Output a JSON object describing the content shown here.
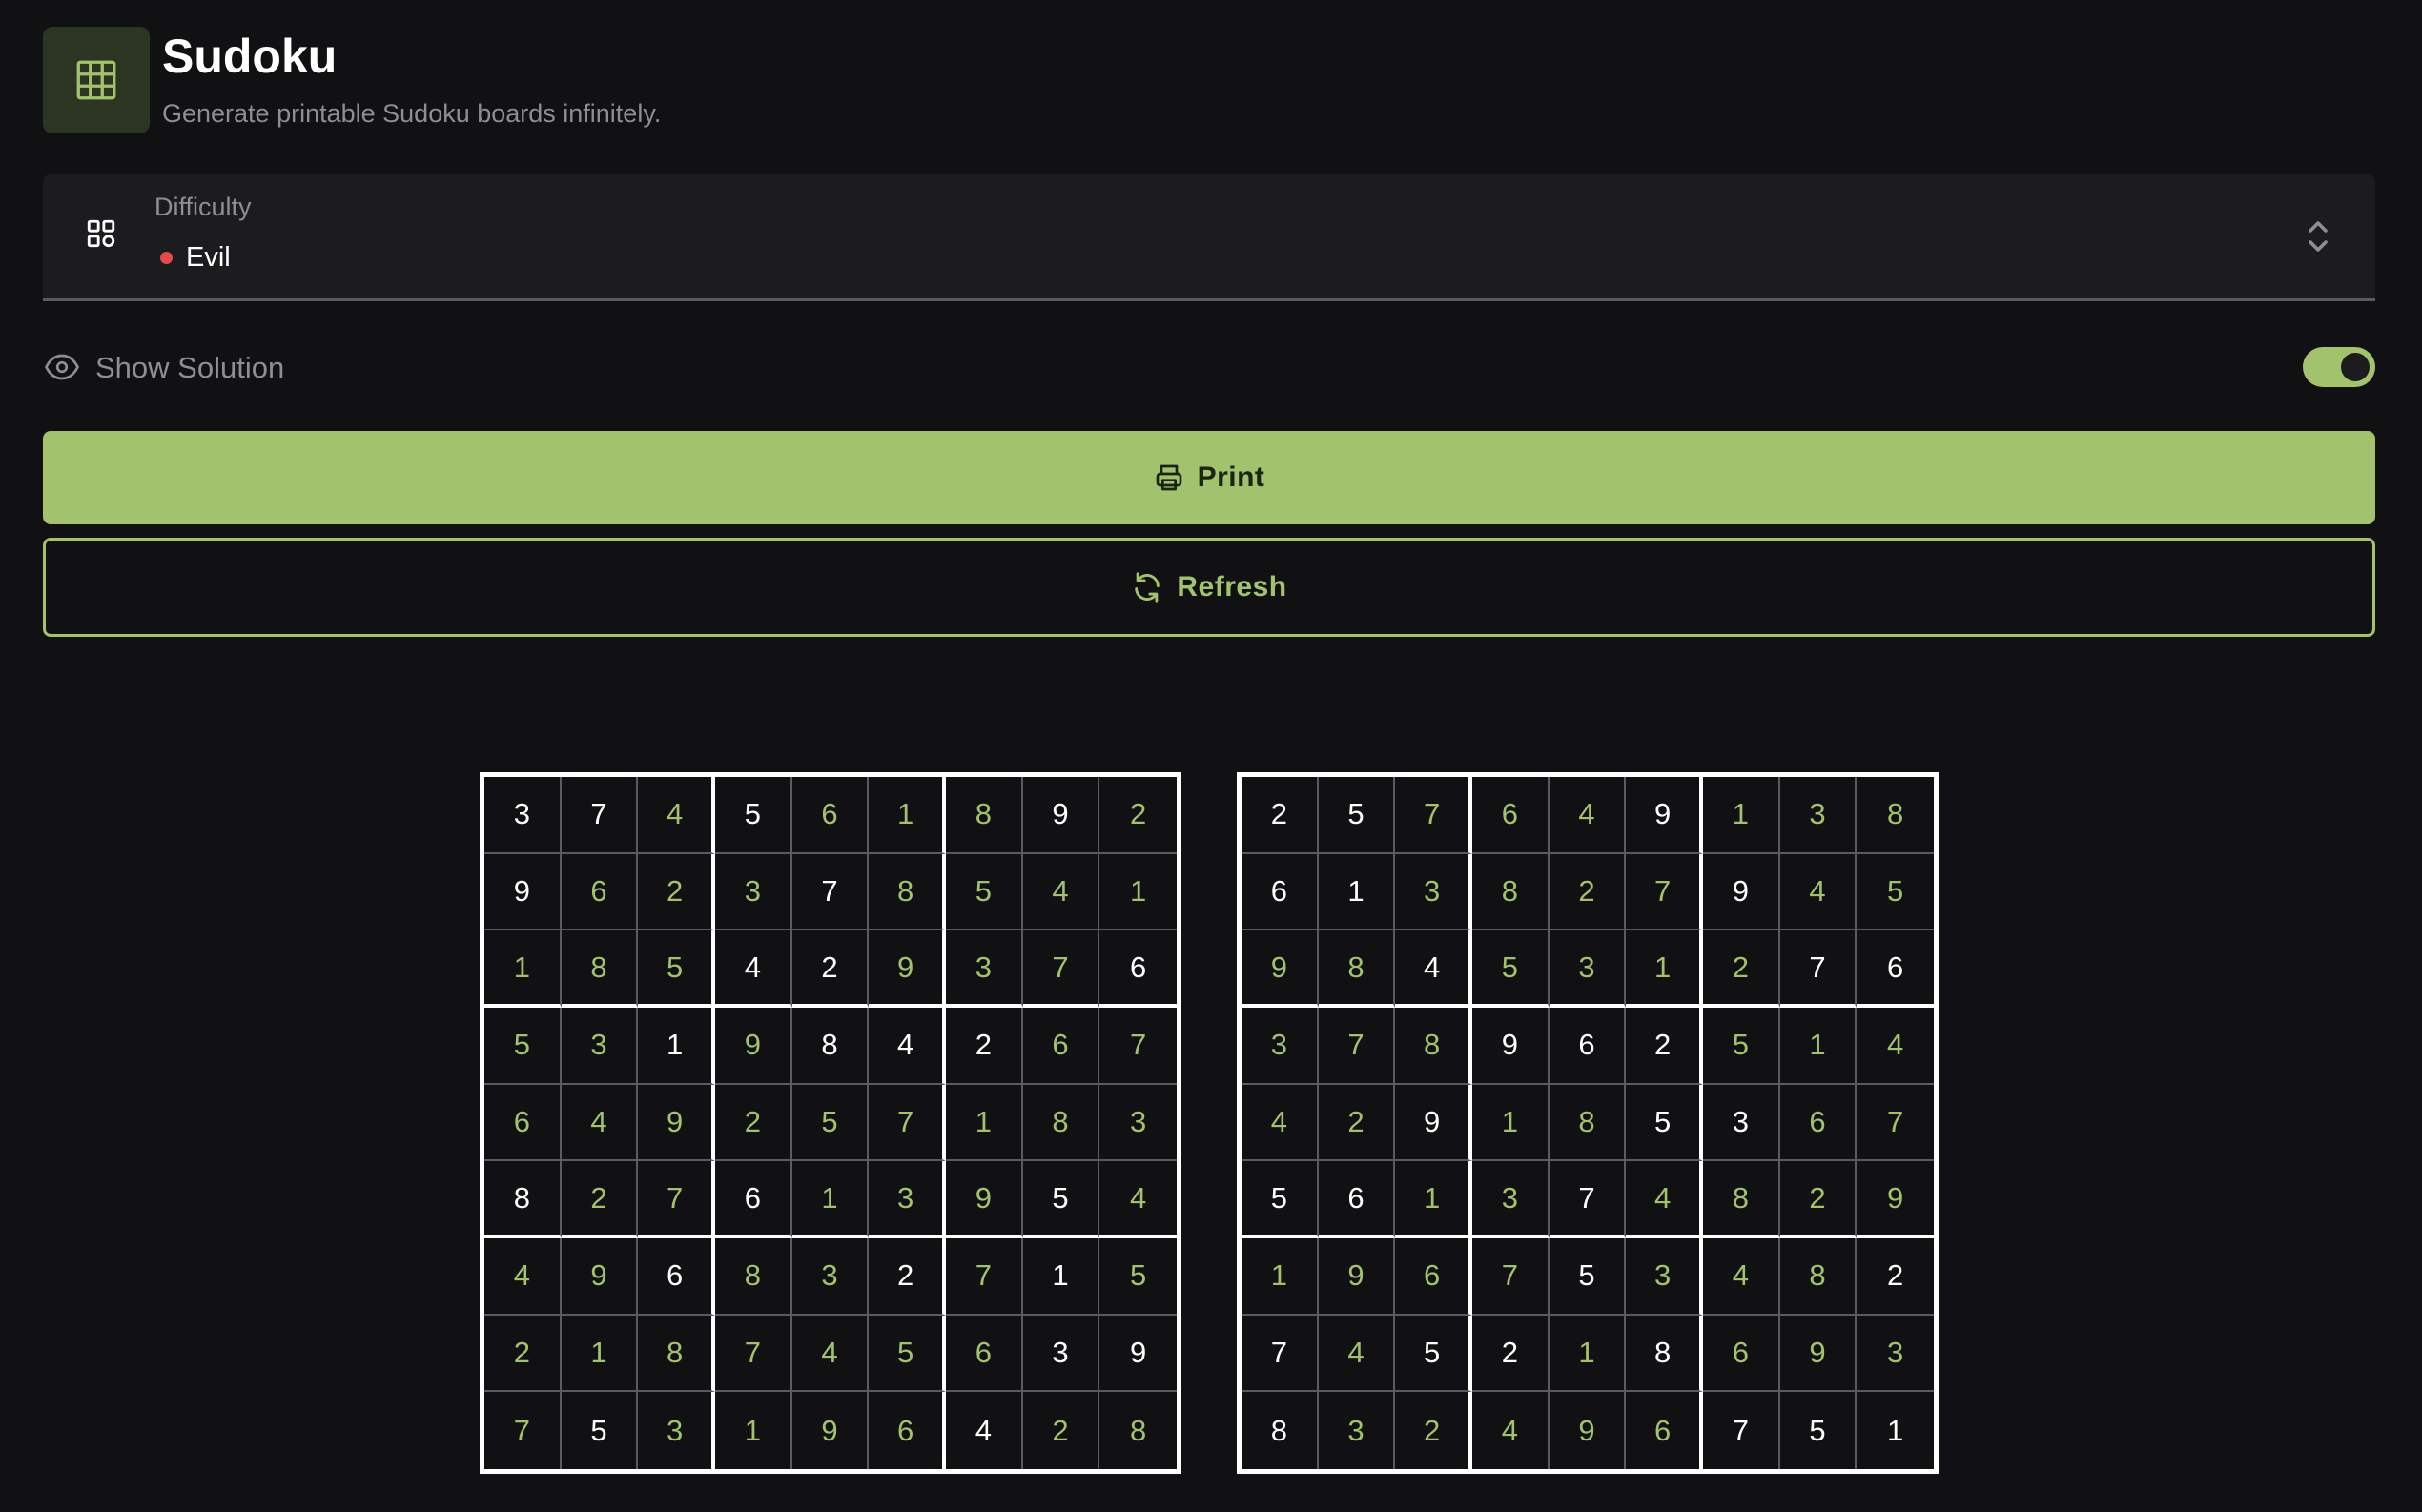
{
  "header": {
    "title": "Sudoku",
    "subtitle": "Generate printable Sudoku boards infinitely.",
    "icon": "grid-icon",
    "accent_color": "#a3c26d"
  },
  "difficulty": {
    "label": "Difficulty",
    "value": "Evil",
    "status_color": "#e5484d",
    "icon": "grid-2x2-icon"
  },
  "solution_toggle": {
    "label": "Show Solution",
    "enabled": true,
    "icon": "eye-icon"
  },
  "actions": {
    "print_label": "Print",
    "refresh_label": "Refresh"
  },
  "boards": [
    {
      "cells": [
        [
          3,
          7,
          4,
          5,
          6,
          1,
          8,
          9,
          2
        ],
        [
          9,
          6,
          2,
          3,
          7,
          8,
          5,
          4,
          1
        ],
        [
          1,
          8,
          5,
          4,
          2,
          9,
          3,
          7,
          6
        ],
        [
          5,
          3,
          1,
          9,
          8,
          4,
          2,
          6,
          7
        ],
        [
          6,
          4,
          9,
          2,
          5,
          7,
          1,
          8,
          3
        ],
        [
          8,
          2,
          7,
          6,
          1,
          3,
          9,
          5,
          4
        ],
        [
          4,
          9,
          6,
          8,
          3,
          2,
          7,
          1,
          5
        ],
        [
          2,
          1,
          8,
          7,
          4,
          5,
          6,
          3,
          9
        ],
        [
          7,
          5,
          3,
          1,
          9,
          6,
          4,
          2,
          8
        ]
      ],
      "given": [
        [
          1,
          1,
          0,
          1,
          0,
          0,
          0,
          1,
          0
        ],
        [
          1,
          0,
          0,
          0,
          1,
          0,
          0,
          0,
          0
        ],
        [
          0,
          0,
          0,
          1,
          1,
          0,
          0,
          0,
          1
        ],
        [
          0,
          0,
          1,
          0,
          1,
          1,
          1,
          0,
          0
        ],
        [
          0,
          0,
          0,
          0,
          0,
          0,
          0,
          0,
          0
        ],
        [
          1,
          0,
          0,
          1,
          0,
          0,
          0,
          1,
          0
        ],
        [
          0,
          0,
          1,
          0,
          0,
          1,
          0,
          1,
          0
        ],
        [
          0,
          0,
          0,
          0,
          0,
          0,
          0,
          1,
          1
        ],
        [
          0,
          1,
          0,
          0,
          0,
          0,
          1,
          0,
          0
        ]
      ]
    },
    {
      "cells": [
        [
          2,
          5,
          7,
          6,
          4,
          9,
          1,
          3,
          8
        ],
        [
          6,
          1,
          3,
          8,
          2,
          7,
          9,
          4,
          5
        ],
        [
          9,
          8,
          4,
          5,
          3,
          1,
          2,
          7,
          6
        ],
        [
          3,
          7,
          8,
          9,
          6,
          2,
          5,
          1,
          4
        ],
        [
          4,
          2,
          9,
          1,
          8,
          5,
          3,
          6,
          7
        ],
        [
          5,
          6,
          1,
          3,
          7,
          4,
          8,
          2,
          9
        ],
        [
          1,
          9,
          6,
          7,
          5,
          3,
          4,
          8,
          2
        ],
        [
          7,
          4,
          5,
          2,
          1,
          8,
          6,
          9,
          3
        ],
        [
          8,
          3,
          2,
          4,
          9,
          6,
          7,
          5,
          1
        ]
      ],
      "given": [
        [
          1,
          1,
          0,
          0,
          0,
          1,
          0,
          0,
          0
        ],
        [
          1,
          1,
          0,
          0,
          0,
          0,
          1,
          0,
          0
        ],
        [
          0,
          0,
          1,
          0,
          0,
          0,
          0,
          1,
          1
        ],
        [
          0,
          0,
          0,
          1,
          1,
          1,
          0,
          0,
          0
        ],
        [
          0,
          0,
          1,
          0,
          0,
          1,
          1,
          0,
          0
        ],
        [
          1,
          1,
          0,
          0,
          1,
          0,
          0,
          0,
          0
        ],
        [
          0,
          0,
          0,
          0,
          1,
          0,
          0,
          0,
          1
        ],
        [
          1,
          0,
          1,
          1,
          0,
          1,
          0,
          0,
          0
        ],
        [
          1,
          0,
          0,
          0,
          0,
          0,
          1,
          1,
          1
        ]
      ]
    }
  ]
}
